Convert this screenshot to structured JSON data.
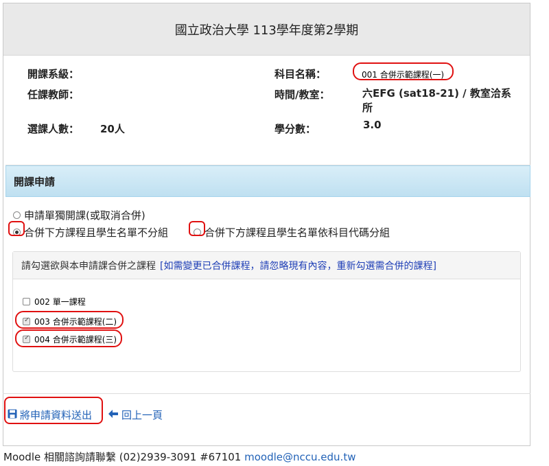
{
  "header": {
    "title": "國立政治大學 113學年度第2學期"
  },
  "course_info": {
    "dept_label": "開課系級：",
    "dept_value": "",
    "teacher_label": "任課教師：",
    "teacher_value": "",
    "enrollment_label": "選課人數：",
    "enrollment_value": "20人",
    "subject_label": "科目名稱：",
    "subject_value": "001 合併示範課程(一)",
    "time_label": "時間/教室：",
    "time_value": "六EFG (sat18-21) / 教室洽系所",
    "credits_label": "學分數：",
    "credits_value": "3.0"
  },
  "application": {
    "heading": "開課申請",
    "options": [
      {
        "label": "申請單獨開課(或取消合併)",
        "selected": false
      },
      {
        "label": "合併下方課程且學生名單不分組",
        "selected": true
      },
      {
        "label": "合併下方課程且學生名單依科目代碼分組",
        "selected": false
      }
    ],
    "merge_panel": {
      "instruction": "請勾選欲與本申請課合併之課程",
      "note": "[如需變更已合併課程，請忽略現有內容，重新勾選需合併的課程]",
      "courses": [
        {
          "label": "002 單一課程",
          "checked": false
        },
        {
          "label": "003 合併示範課程(二)",
          "checked": true
        },
        {
          "label": "004 合併示範課程(三)",
          "checked": true
        }
      ]
    }
  },
  "actions": {
    "submit_label": "將申請資料送出",
    "back_label": "回上一頁"
  },
  "footer": {
    "text": "Moodle 相關諮詢請聯繫 (02)2939-3091 #67101",
    "email": "moodle@nccu.edu.tw"
  },
  "icons": {
    "submit": "save-icon",
    "back": "arrow-left-icon"
  },
  "colors": {
    "link": "#2262b7",
    "highlight": "#e01010",
    "panel_header": "#c7e5f4"
  }
}
